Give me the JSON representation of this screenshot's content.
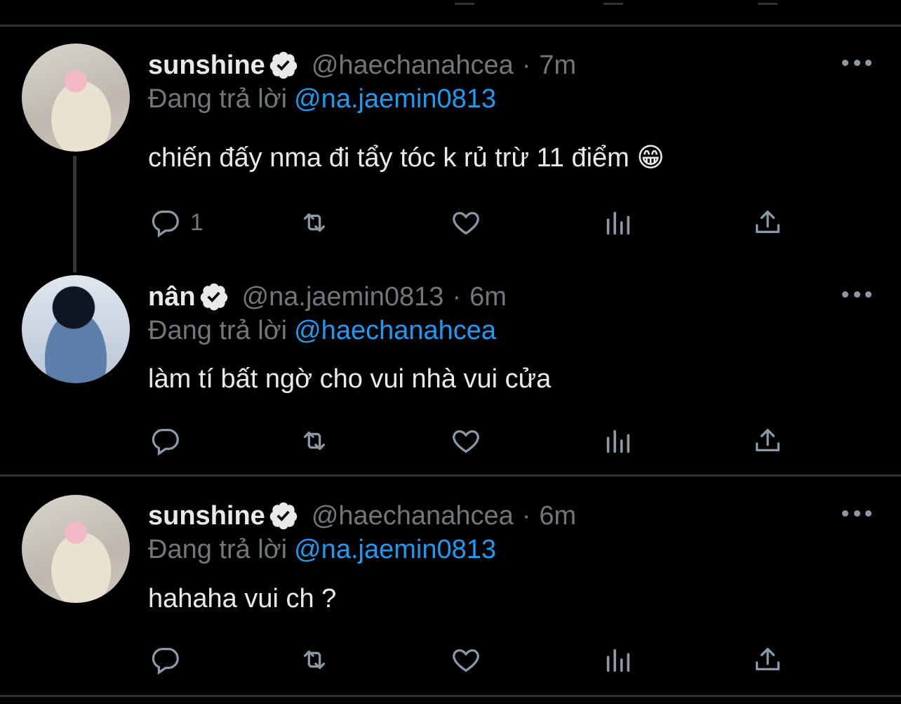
{
  "tweets": [
    {
      "name": "sunshine",
      "handle": "@haechanahcea",
      "separator": "·",
      "time": "7m",
      "reply_label": "Đang trả lời",
      "reply_mention": "@na.jaemin0813",
      "text": "chiến đấy nma đi tẩy tóc k rủ trừ 11 điểm 😁",
      "reply_count": "1"
    },
    {
      "name": "nân",
      "handle": "@na.jaemin0813",
      "separator": "·",
      "time": "6m",
      "reply_label": "Đang trả lời",
      "reply_mention": "@haechanahcea",
      "text": "làm tí bất ngờ cho vui nhà vui cửa",
      "reply_count": ""
    },
    {
      "name": "sunshine",
      "handle": "@haechanahcea",
      "separator": "·",
      "time": "6m",
      "reply_label": "Đang trả lời",
      "reply_mention": "@na.jaemin0813",
      "text": "hahaha vui ch ?",
      "reply_count": ""
    }
  ],
  "colors": {
    "background": "#000000",
    "text": "#e7e9ea",
    "secondary": "#71767b",
    "link": "#1d9bf0",
    "divider": "#2f3336"
  },
  "icons": [
    "reply-icon",
    "retweet-icon",
    "like-icon",
    "views-icon",
    "share-icon",
    "more-icon",
    "verified-icon"
  ]
}
